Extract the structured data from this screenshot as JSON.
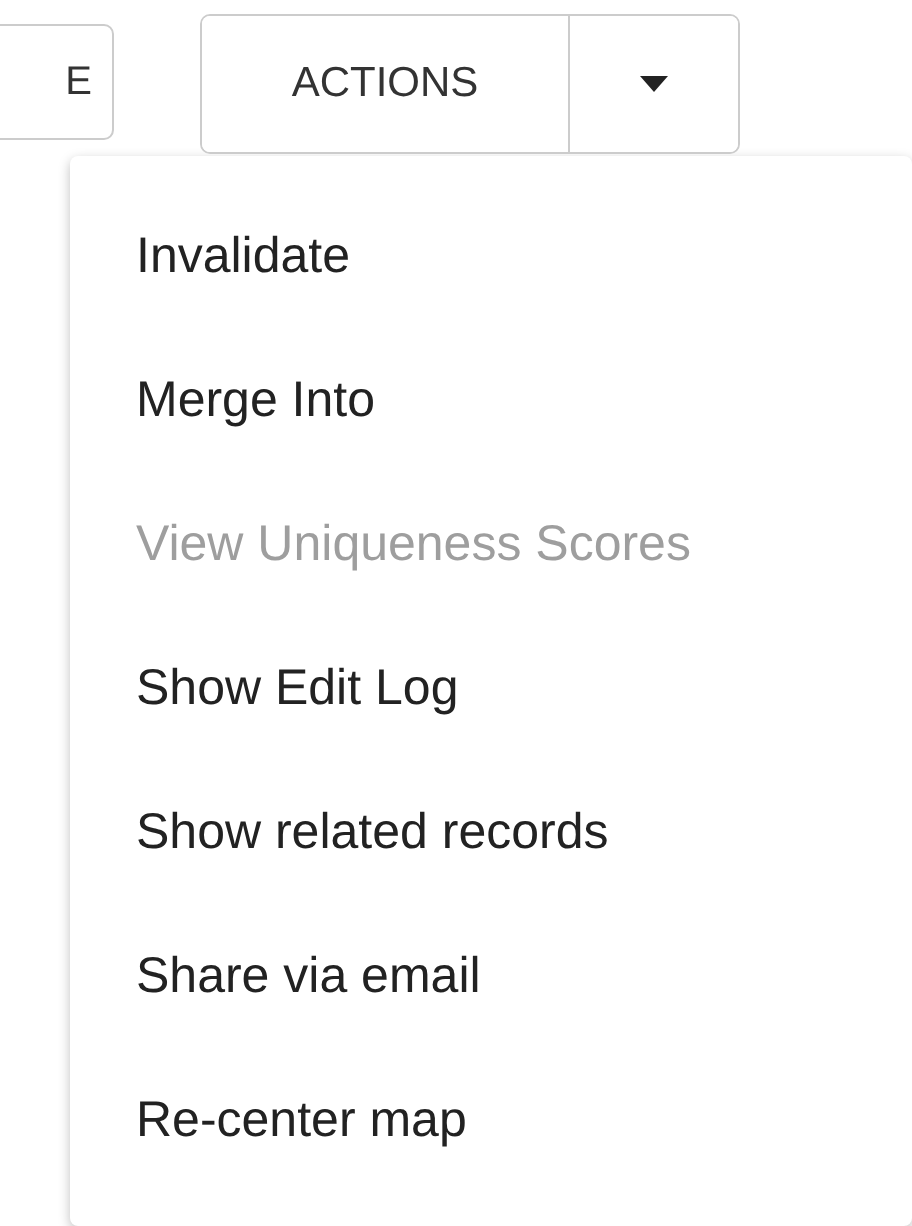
{
  "toolbar": {
    "partial_button": {
      "label": "E"
    },
    "actions_button": {
      "label": "ACTIONS",
      "expanded": true
    }
  },
  "menu": {
    "items": [
      {
        "label": "Invalidate",
        "disabled": false
      },
      {
        "label": "Merge Into",
        "disabled": false
      },
      {
        "label": "View Uniqueness Scores",
        "disabled": true
      },
      {
        "label": "Show Edit Log",
        "disabled": false
      },
      {
        "label": "Show related records",
        "disabled": false
      },
      {
        "label": "Share via email",
        "disabled": false
      },
      {
        "label": "Re-center map",
        "disabled": false
      }
    ]
  }
}
